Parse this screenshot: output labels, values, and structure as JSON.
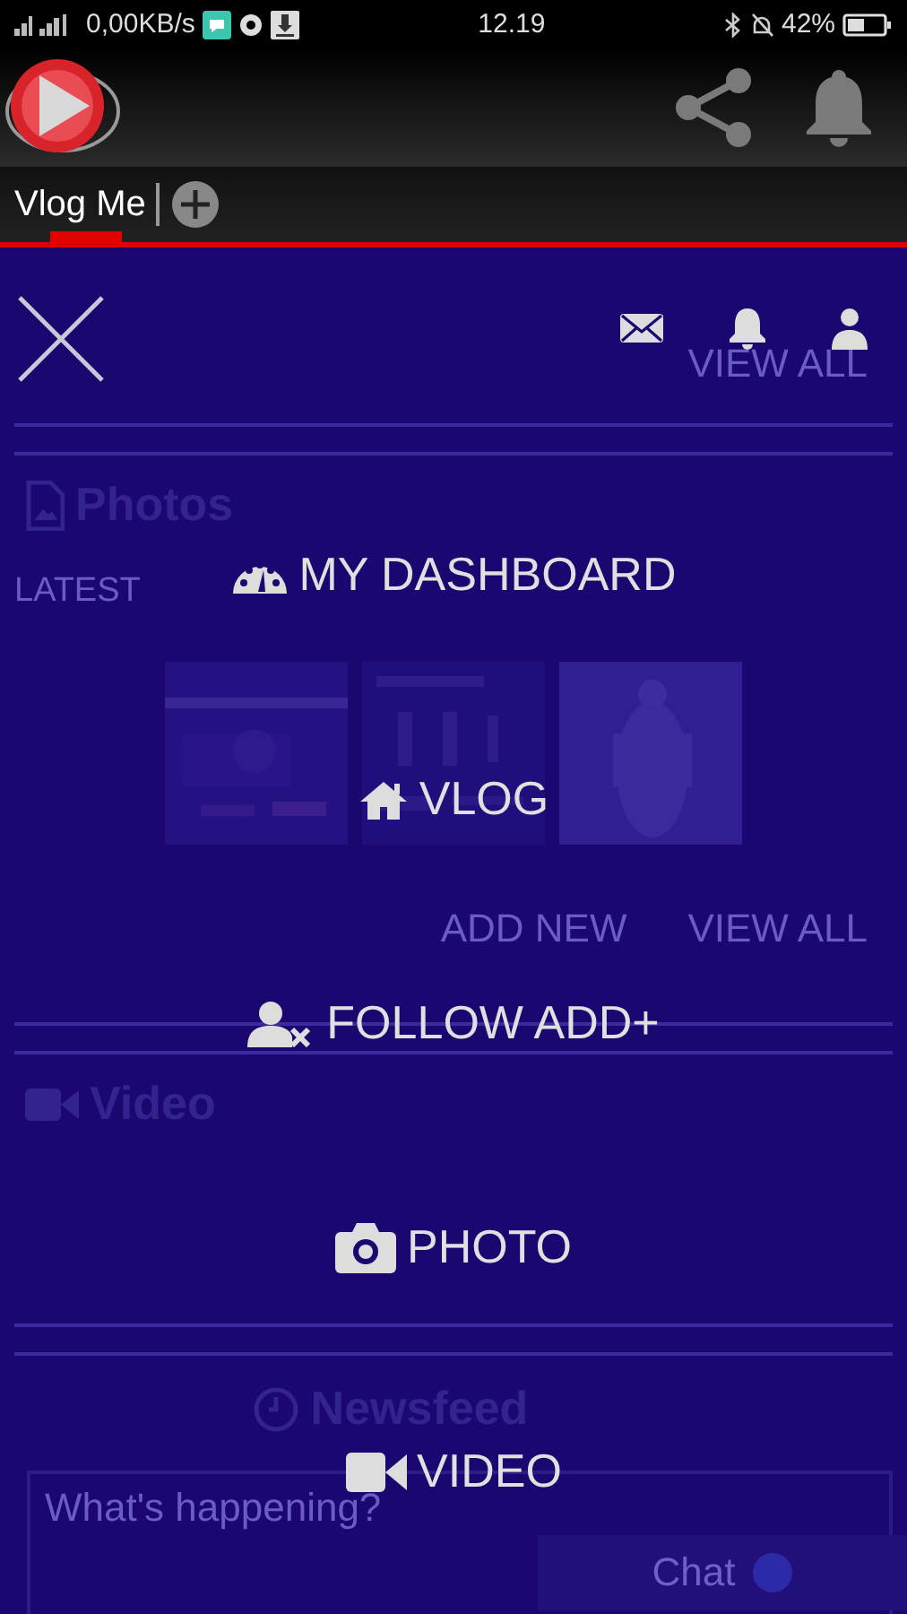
{
  "status_bar": {
    "network_speed": "0,00KB/s",
    "time": "12.19",
    "battery": "42%"
  },
  "tabs": [
    {
      "label": "Vlog Me",
      "selected": true
    }
  ],
  "background_page": {
    "top_link": "VIEW ALL",
    "photos": {
      "title": "Photos",
      "filter": "LATEST",
      "thumbnails": [
        {
          "kind": "picture"
        },
        {
          "kind": "picture"
        },
        {
          "kind": "picture"
        }
      ],
      "actions": [
        "ADD NEW",
        "VIEW ALL"
      ]
    },
    "video": {
      "title": "Video"
    },
    "newsfeed": {
      "title": "Newsfeed",
      "composer": {
        "placeholder": "What's happening?"
      },
      "chat": {
        "label": "Chat"
      }
    }
  },
  "menu": {
    "items": [
      {
        "label": "MY DASHBOARD"
      },
      {
        "label": "VLOG"
      },
      {
        "label": "FOLLOW ADD+"
      },
      {
        "label": "PHOTO"
      },
      {
        "label": "VIDEO"
      }
    ]
  }
}
